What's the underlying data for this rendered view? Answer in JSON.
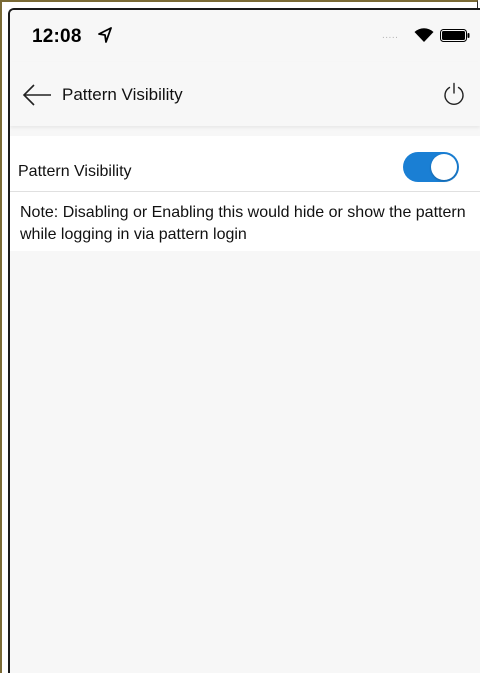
{
  "status_bar": {
    "time": "12:08",
    "location_icon": "location-arrow-icon",
    "signal_dots": ".....",
    "wifi_icon": "wifi-icon",
    "battery_icon": "battery-icon"
  },
  "app_bar": {
    "back_icon": "back-arrow-icon",
    "title": "Pattern Visibility",
    "power_icon": "power-icon"
  },
  "settings": {
    "pattern_visibility": {
      "label": "Pattern Visibility",
      "enabled": true,
      "toggle_color": "#1a7fd4"
    },
    "note": "Note: Disabling or Enabling this would hide or show the pattern while logging in via pattern login"
  }
}
